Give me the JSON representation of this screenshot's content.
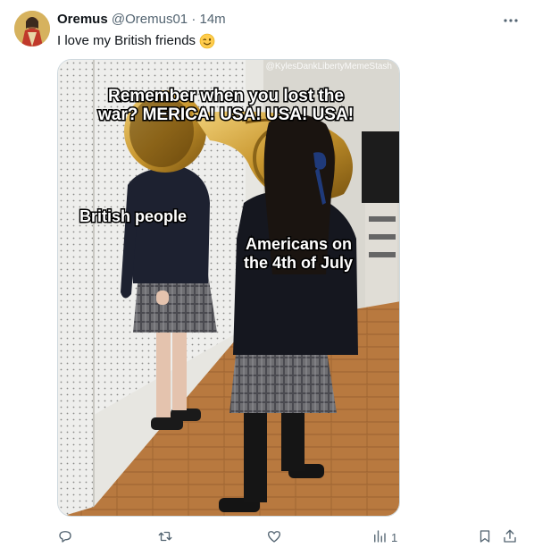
{
  "tweet": {
    "author_name": "Oremus",
    "author_handle": "@Oremus01",
    "separator": "·",
    "time": "14m",
    "text": "I love my British friends",
    "text_emoji_icon": "winking-face-emoji"
  },
  "meme": {
    "watermark": "@KylesDankLibertyMemeStash",
    "caption_line1": "Remember when you lost the",
    "caption_line2": "war? MERICA! USA! USA! USA!",
    "label_left": "British people",
    "label_right_line1": "Americans on",
    "label_right_line2": "the 4th of July"
  },
  "actions": {
    "reply_icon": "reply-icon",
    "retweet_icon": "retweet-icon",
    "like_icon": "heart-icon",
    "views_icon": "views-icon",
    "views_count": "1",
    "bookmark_icon": "bookmark-icon",
    "share_icon": "share-icon"
  },
  "colors": {
    "text_primary": "#0f1419",
    "text_secondary": "#536471",
    "border": "#cfd9de"
  }
}
